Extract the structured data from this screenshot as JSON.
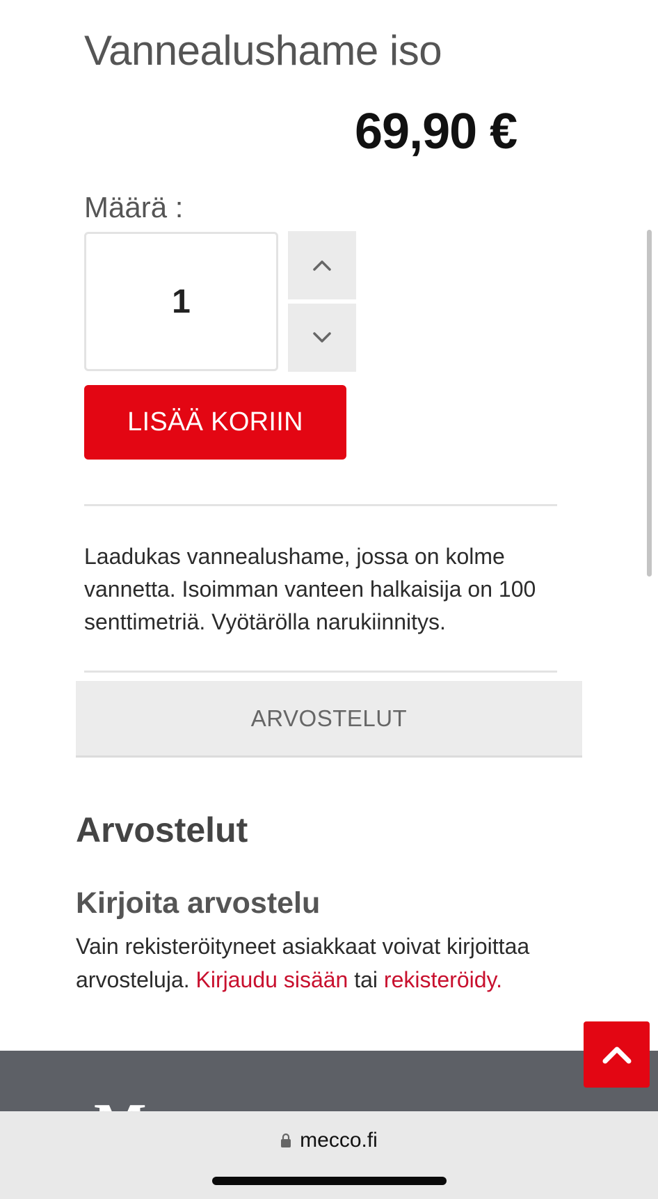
{
  "product": {
    "title": "Vannealushame iso",
    "price": "69,90 €"
  },
  "quantity": {
    "label": "Määrä :",
    "value": "1"
  },
  "cart": {
    "add_label": "LISÄÄ KORIIN"
  },
  "description": "Laadukas vannealushame, jossa on kolme vannetta. Isoimman vanteen halkaisija on 100 senttimetriä. Vyötärölla narukiinnitys.",
  "tabs": {
    "reviews_label": "ARVOSTELUT"
  },
  "reviews": {
    "heading": "Arvostelut",
    "write_heading": "Kirjoita arvostelu",
    "note_text": "Vain rekisteröityneet asiakkaat voivat kirjoittaa arvosteluja.",
    "login_link": "Kirjaudu sisään",
    "or_text": "tai",
    "register_link": "rekisteröidy."
  },
  "footer": {
    "logo_letter": "M"
  },
  "browser": {
    "url": "mecco.fi"
  },
  "colors": {
    "accent_red": "#e30613",
    "link_red": "#c8102e",
    "footer_gray": "#5d6066"
  },
  "icons": {
    "up": "chevron-up-icon",
    "down": "chevron-down-icon",
    "back_to_top": "chevron-up-icon",
    "lock": "lock-icon"
  }
}
